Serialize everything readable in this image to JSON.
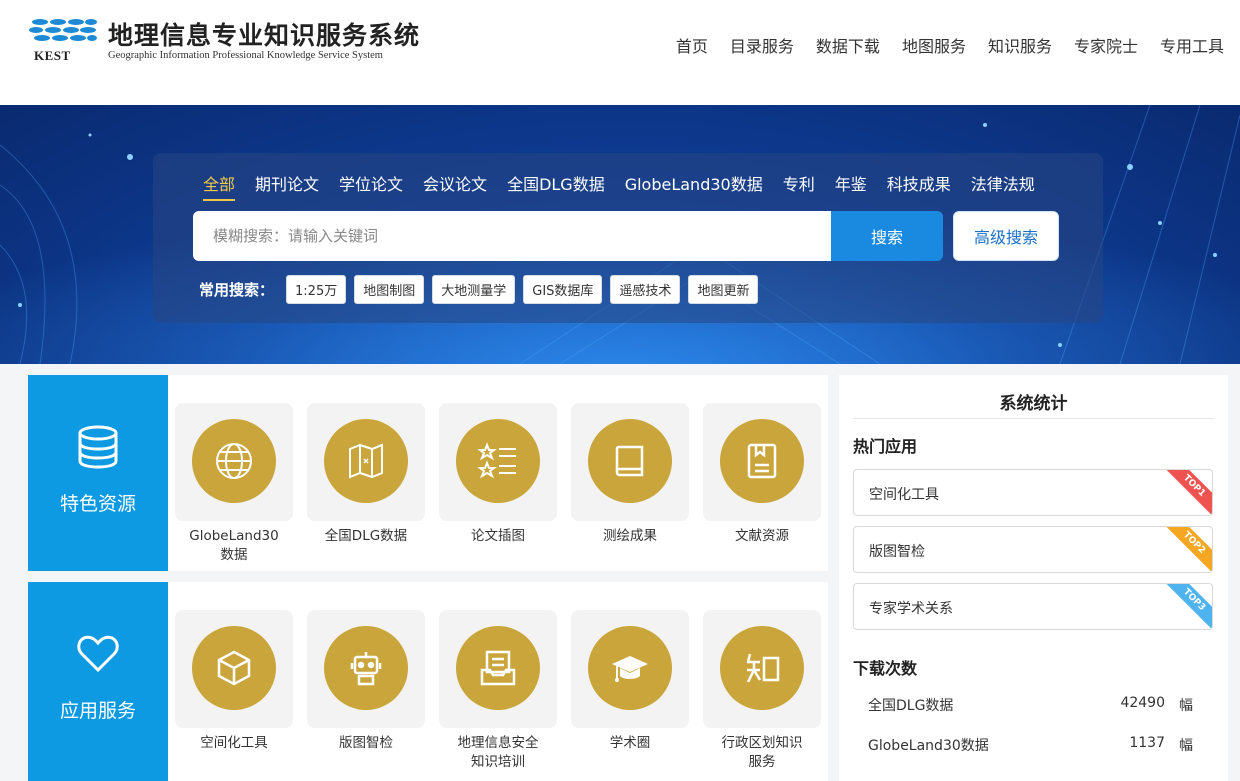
{
  "site": {
    "title": "地理信息专业知识服务系统",
    "subtitle": "Geographic Information Professional Knowledge Service System",
    "abbr": "KEST"
  },
  "nav": [
    "首页",
    "目录服务",
    "数据下载",
    "地图服务",
    "知识服务",
    "专家院士",
    "专用工具"
  ],
  "search": {
    "tabs": [
      "全部",
      "期刊论文",
      "学位论文",
      "会议论文",
      "全国DLG数据",
      "GlobeLand30数据",
      "专利",
      "年鉴",
      "科技成果",
      "法律法规"
    ],
    "active_tab": "全部",
    "placeholder": "模糊搜索：请输入关键词",
    "button": "搜索",
    "advanced": "高级搜索",
    "common_label": "常用搜索：",
    "common_tags": [
      "1:25万",
      "地图制图",
      "大地测量学",
      "GIS数据库",
      "遥感技术",
      "地图更新"
    ]
  },
  "featured": {
    "title": "特色资源",
    "items": [
      {
        "label": "GlobeLand30\n数据",
        "icon": "globe-icon"
      },
      {
        "label": "全国DLG数据",
        "icon": "map-icon"
      },
      {
        "label": "论文插图",
        "icon": "star-list-icon"
      },
      {
        "label": "测绘成果",
        "icon": "book-icon"
      },
      {
        "label": "文献资源",
        "icon": "document-icon"
      }
    ]
  },
  "services": {
    "title": "应用服务",
    "items": [
      {
        "label": "空间化工具",
        "icon": "cube-icon"
      },
      {
        "label": "版图智检",
        "icon": "robot-icon"
      },
      {
        "label": "地理信息安全\n知识培训",
        "icon": "inbox-icon"
      },
      {
        "label": "学术圈",
        "icon": "graduation-cap-icon"
      },
      {
        "label": "行政区划知识\n服务",
        "icon": "knowledge-icon"
      }
    ]
  },
  "stats": {
    "title": "系统统计",
    "hot_title": "热门应用",
    "hot": [
      {
        "label": "空间化工具",
        "rank": "TOP1",
        "color": "#ef5350"
      },
      {
        "label": "版图智检",
        "rank": "TOP2",
        "color": "#f5a623"
      },
      {
        "label": "专家学术关系",
        "rank": "TOP3",
        "color": "#4fb3f0"
      }
    ],
    "download_title": "下载次数",
    "downloads": [
      {
        "name": "全国DLG数据",
        "count": "42490",
        "unit": "幅"
      },
      {
        "name": "GlobeLand30数据",
        "count": "1137",
        "unit": "幅"
      }
    ]
  },
  "colors": {
    "accent": "#0d9ae2",
    "gold": "#c9a53b",
    "active_tab": "#f2c84b"
  }
}
